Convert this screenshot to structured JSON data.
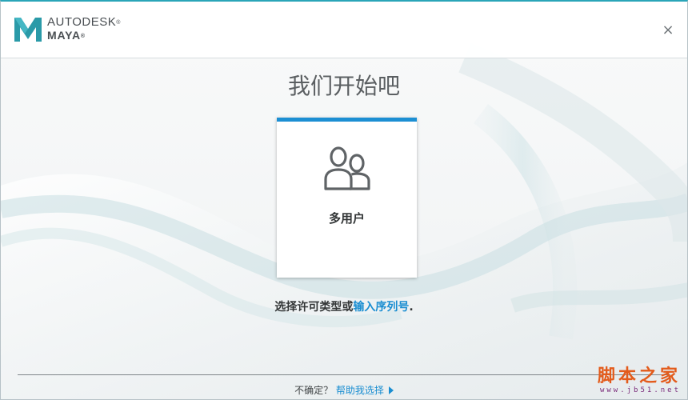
{
  "header": {
    "brand_line1": "AUTODESK",
    "brand_line2": "MAYA",
    "reg_mark": "®",
    "close_glyph": "×"
  },
  "main": {
    "title": "我们开始吧",
    "card": {
      "label": "多用户",
      "icon": "two-users-icon",
      "accent_color": "#1c8fd3"
    },
    "license_prompt": "选择许可类型或",
    "serial_link": "输入序列号",
    "license_suffix": "."
  },
  "footer": {
    "question": "不确定？",
    "help_link": "帮助我选择"
  },
  "watermark": {
    "text": "脚本之家",
    "url": "www.jb51.net"
  },
  "colors": {
    "accent": "#1b8ed1",
    "brand_teal": "#2aa5b8"
  }
}
